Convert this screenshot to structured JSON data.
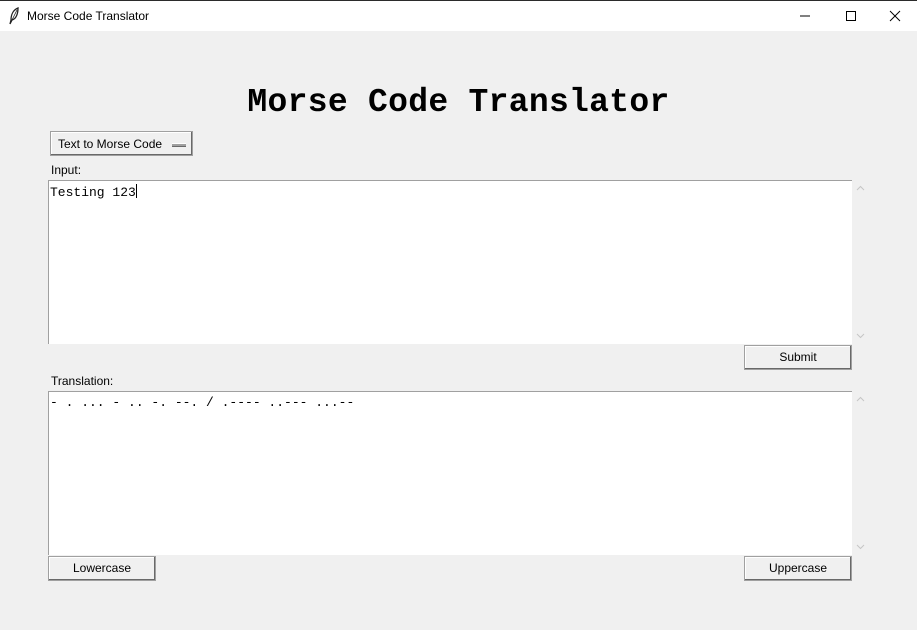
{
  "window": {
    "title": "Morse Code Translator",
    "app_icon": "feather-icon",
    "controls": [
      "minimize-icon",
      "maximize-icon",
      "close-icon"
    ]
  },
  "heading": "Morse Code Translator",
  "mode_menu": {
    "selected": "Text to Morse Code"
  },
  "input": {
    "label": "Input:",
    "value": "Testing 123"
  },
  "submit_label": "Submit",
  "translation": {
    "label": "Translation:",
    "value": "- . ... - .. -. --. / .---- ..--- ...--"
  },
  "lowercase_label": "Lowercase",
  "uppercase_label": "Uppercase"
}
